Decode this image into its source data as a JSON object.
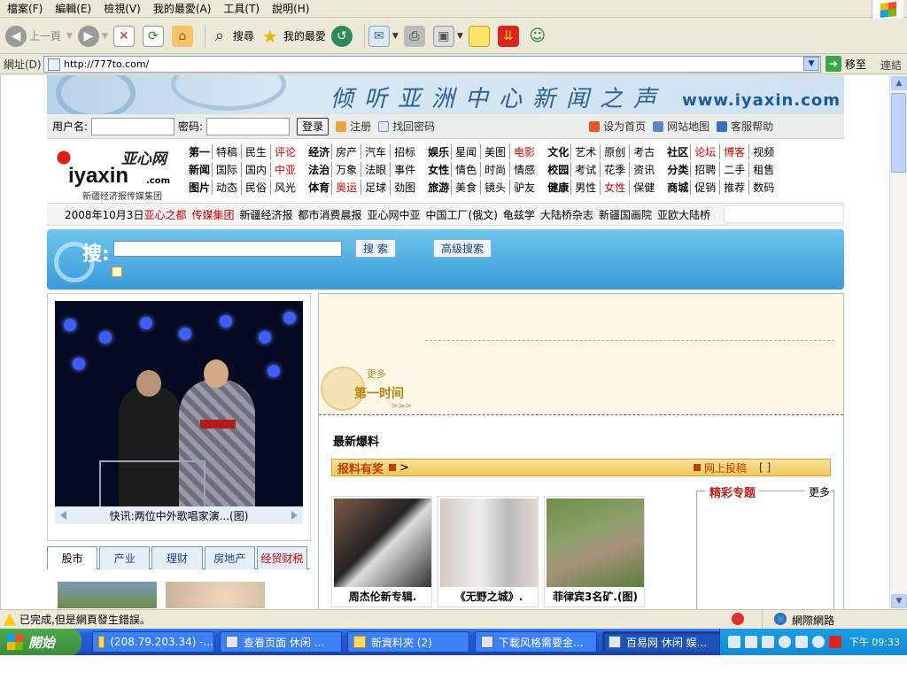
{
  "menubar": [
    "檔案(F)",
    "編輯(E)",
    "檢視(V)",
    "我的最愛(A)",
    "工具(T)",
    "說明(H)"
  ],
  "toolbar": {
    "back": "上一頁",
    "search": "搜尋",
    "favorites": "我的最愛"
  },
  "address": {
    "label": "網址(D)",
    "url": "http://777to.com/",
    "go": "移至",
    "links": "連結"
  },
  "page": {
    "banner_slogan": "倾听亚洲中心新闻之声",
    "banner_url": "www.iyaxin.com",
    "login": {
      "user_label": "用户名:",
      "pass_label": "密码:",
      "login_btn": "登录",
      "register": "注册",
      "find_password": "找回密码",
      "set_home": "设为首页",
      "sitemap": "网站地图",
      "help": "客服帮助"
    },
    "logo": {
      "cn": "亚心网",
      "en": "iyaxin",
      "com": ".com",
      "sub": "新疆经济报传媒集团"
    },
    "nav": [
      [
        {
          "head": "第一",
          "items": [
            "特稿",
            "民生",
            "评论"
          ],
          "red": [
            2
          ]
        },
        {
          "head": "经济",
          "items": [
            "房产",
            "汽车",
            "招标"
          ],
          "red": []
        },
        {
          "head": "娱乐",
          "items": [
            "星闻",
            "美图",
            "电影"
          ],
          "red": [
            2
          ]
        },
        {
          "head": "文化",
          "items": [
            "艺术",
            "原创",
            "考古"
          ],
          "red": []
        },
        {
          "head": "社区",
          "items": [
            "论坛",
            "博客",
            "视频"
          ],
          "red": [
            0,
            1
          ]
        }
      ],
      [
        {
          "head": "新闻",
          "items": [
            "国际",
            "国内",
            "中亚"
          ],
          "red": [
            2
          ]
        },
        {
          "head": "法治",
          "items": [
            "万象",
            "法眼",
            "事件"
          ],
          "red": []
        },
        {
          "head": "女性",
          "items": [
            "情色",
            "时尚",
            "情感"
          ],
          "red": []
        },
        {
          "head": "校园",
          "items": [
            "考试",
            "花季",
            "资讯"
          ],
          "red": []
        },
        {
          "head": "分类",
          "items": [
            "招聘",
            "二手",
            "租售"
          ],
          "red": []
        }
      ],
      [
        {
          "head": "图片",
          "items": [
            "动态",
            "民俗",
            "风光"
          ],
          "red": []
        },
        {
          "head": "体育",
          "items": [
            "奥运",
            "足球",
            "劲图"
          ],
          "red": [
            0
          ]
        },
        {
          "head": "旅游",
          "items": [
            "美食",
            "镜头",
            "驴友"
          ],
          "red": []
        },
        {
          "head": "健康",
          "items": [
            "男性",
            "女性",
            "保健"
          ],
          "red": [
            1
          ]
        },
        {
          "head": "商城",
          "items": [
            "促销",
            "推荐",
            "数码"
          ],
          "red": []
        }
      ]
    ],
    "ticker": {
      "date": "2008年10月3日",
      "red_items": [
        "亚心之都",
        "传媒集团"
      ],
      "items": [
        "新疆经济报",
        "都市消费晨报",
        "亚心网中亚",
        "中国工厂(俄文)",
        "龟兹学",
        "大陆桥杂志",
        "新疆国画院",
        "亚欧大陆桥"
      ]
    },
    "search": {
      "label": "搜:",
      "btn_search": "搜 索",
      "btn_advanced": "高级搜索"
    },
    "photo_caption": "快讯:两位中外歌唱家演...(图)",
    "tabs": [
      "股市",
      "产业",
      "理财",
      "房地产",
      "经贸财税"
    ],
    "first_news": {
      "more": "更多",
      "title": "第一时间",
      "arrows": ">>>"
    },
    "latest_title": "最新爆料",
    "baoliao": {
      "title": "报料有奖",
      "arrow": ">",
      "submit": "网上投稿",
      "brackets": "[ ]"
    },
    "thumbs": [
      {
        "caption": "周杰伦新专辑."
      },
      {
        "caption": "《无野之城》."
      },
      {
        "caption": "菲律宾3名矿.(图)"
      }
    ],
    "special": {
      "title": "精彩专题",
      "more": "更多"
    }
  },
  "status": {
    "text": "已完成,但是網頁發生錯誤。",
    "zone": "網際網路"
  },
  "taskbar": {
    "start": "開始",
    "tasks": [
      "(208.79.203.34) -...",
      "查看页面 休闲 ...",
      "新資料夾 (2)",
      "下載风格需要金...",
      "百易网 休闲 娱..."
    ],
    "active_index": 4,
    "clock": "下午 09:33"
  },
  "colors": {
    "accent_red": "#d40000",
    "search_blue": "#3a9ad8",
    "xp_taskbar": "#245edb"
  }
}
